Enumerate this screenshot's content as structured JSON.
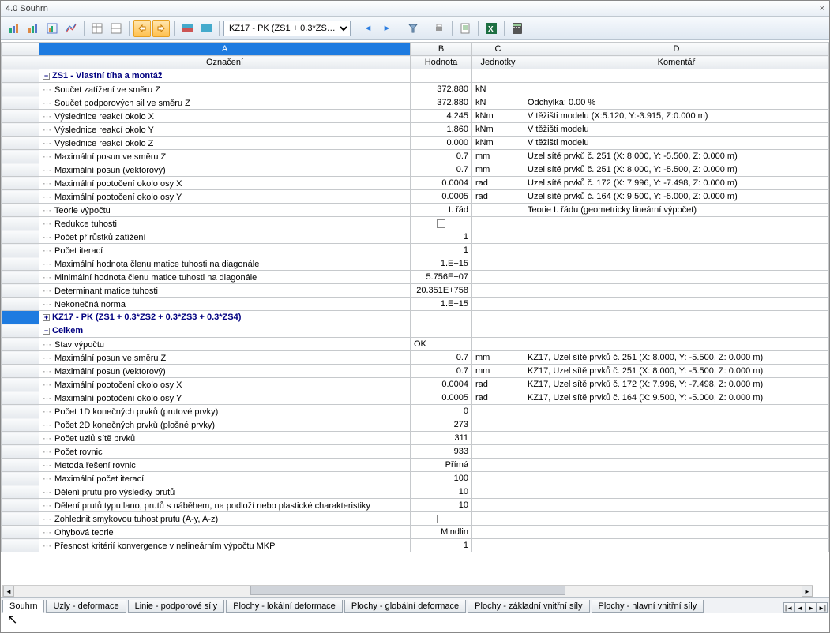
{
  "window": {
    "title": "4.0 Souhrn"
  },
  "toolbar": {
    "combo": "KZ17 - PK (ZS1 + 0.3*ZS…"
  },
  "headers": {
    "A": "A",
    "B": "B",
    "C": "C",
    "D": "D",
    "oznaceni": "Označení",
    "hodnota": "Hodnota",
    "jednotky": "Jednotky",
    "komentar": "Komentář"
  },
  "groups": {
    "zs1": "ZS1 - Vlastní tíha a montáž",
    "kz17": "KZ17 - PK (ZS1 + 0.3*ZS2 + 0.3*ZS3 + 0.3*ZS4)",
    "celkem": "Celkem"
  },
  "rows_zs1": [
    {
      "a": "Součet zatížení ve směru Z",
      "b": "372.880",
      "c": "kN",
      "d": ""
    },
    {
      "a": "Součet podporových sil ve směru Z",
      "b": "372.880",
      "c": "kN",
      "d": "Odchylka:  0.00 %"
    },
    {
      "a": "Výslednice reakcí okolo X",
      "b": "4.245",
      "c": "kNm",
      "d": "V těžišti modelu (X:5.120, Y:-3.915, Z:0.000 m)"
    },
    {
      "a": "Výslednice reakcí okolo Y",
      "b": "1.860",
      "c": "kNm",
      "d": "V těžišti modelu"
    },
    {
      "a": "Výslednice reakcí okolo Z",
      "b": "0.000",
      "c": "kNm",
      "d": "V těžišti modelu"
    },
    {
      "a": "Maximální posun ve směru Z",
      "b": "0.7",
      "c": "mm",
      "d": "Uzel sítě prvků č. 251  (X: 8.000,  Y: -5.500,  Z: 0.000 m)"
    },
    {
      "a": "Maximální posun (vektorový)",
      "b": "0.7",
      "c": "mm",
      "d": "Uzel sítě prvků č. 251  (X: 8.000,  Y: -5.500,  Z: 0.000 m)"
    },
    {
      "a": "Maximální pootočení okolo osy X",
      "b": "0.0004",
      "c": "rad",
      "d": "Uzel sítě prvků č. 172  (X: 7.996,  Y: -7.498,  Z: 0.000 m)"
    },
    {
      "a": "Maximální pootočení okolo osy Y",
      "b": "0.0005",
      "c": "rad",
      "d": "Uzel sítě prvků č. 164  (X: 9.500,  Y: -5.000,  Z: 0.000 m)"
    },
    {
      "a": "Teorie výpočtu",
      "b": "I. řád",
      "c": "",
      "d": "Teorie I. řádu (geometricky lineární výpočet)"
    },
    {
      "a": "Redukce tuhosti",
      "b": "[cb]",
      "c": "",
      "d": ""
    },
    {
      "a": "Počet přírůstků zatížení",
      "b": "1",
      "c": "",
      "d": ""
    },
    {
      "a": "Počet iterací",
      "b": "1",
      "c": "",
      "d": ""
    },
    {
      "a": "Maximální hodnota členu matice tuhosti na diagonále",
      "b": "1.E+15",
      "c": "",
      "d": ""
    },
    {
      "a": "Minimální hodnota členu matice tuhosti na diagonále",
      "b": "5.756E+07",
      "c": "",
      "d": ""
    },
    {
      "a": "Determinant matice tuhosti",
      "b": "20.351E+758",
      "c": "",
      "d": ""
    },
    {
      "a": "Nekonečná norma",
      "b": "1.E+15",
      "c": "",
      "d": ""
    }
  ],
  "rows_celkem": [
    {
      "a": "Stav výpočtu",
      "b": "OK",
      "c": "",
      "d": "",
      "bleft": true
    },
    {
      "a": "Maximální posun ve směru Z",
      "b": "0.7",
      "c": "mm",
      "d": "KZ17, Uzel sítě prvků č. 251  (X: 8.000,  Y: -5.500,  Z: 0.000 m)"
    },
    {
      "a": "Maximální posun (vektorový)",
      "b": "0.7",
      "c": "mm",
      "d": "KZ17, Uzel sítě prvků č. 251  (X: 8.000,  Y: -5.500,  Z: 0.000 m)"
    },
    {
      "a": "Maximální pootočení okolo osy X",
      "b": "0.0004",
      "c": "rad",
      "d": "KZ17, Uzel sítě prvků č. 172  (X: 7.996,  Y: -7.498,  Z: 0.000 m)"
    },
    {
      "a": "Maximální pootočení okolo osy Y",
      "b": "0.0005",
      "c": "rad",
      "d": "KZ17, Uzel sítě prvků č. 164  (X: 9.500,  Y: -5.000,  Z: 0.000 m)"
    },
    {
      "a": "Počet 1D konečných prvků (prutové prvky)",
      "b": "0",
      "c": "",
      "d": ""
    },
    {
      "a": "Počet 2D konečných prvků (plošné prvky)",
      "b": "273",
      "c": "",
      "d": ""
    },
    {
      "a": "Počet uzlů sítě prvků",
      "b": "311",
      "c": "",
      "d": ""
    },
    {
      "a": "Počet rovnic",
      "b": "933",
      "c": "",
      "d": ""
    },
    {
      "a": "Metoda řešení rovnic",
      "b": "Přímá",
      "c": "",
      "d": ""
    },
    {
      "a": "Maximální počet iterací",
      "b": "100",
      "c": "",
      "d": ""
    },
    {
      "a": "Dělení prutu pro výsledky prutů",
      "b": "10",
      "c": "",
      "d": ""
    },
    {
      "a": "Dělení prutů typu lano, prutů s náběhem, na podloží nebo plastické charakteristiky",
      "b": "10",
      "c": "",
      "d": ""
    },
    {
      "a": "Zohlednit smykovou tuhost prutu (A-y, A-z)",
      "b": "[cb]",
      "c": "",
      "d": ""
    },
    {
      "a": "Ohybová teorie",
      "b": "Mindlin",
      "c": "",
      "d": ""
    },
    {
      "a": "Přesnost kritérií konvergence v nelineárním výpočtu MKP",
      "b": "1",
      "c": "",
      "d": ""
    }
  ],
  "tabs": [
    "Souhrn",
    "Uzly - deformace",
    "Linie - podporové síly",
    "Plochy - lokální deformace",
    "Plochy - globální deformace",
    "Plochy - základní vnitřní síly",
    "Plochy - hlavní vnitřní síly"
  ]
}
